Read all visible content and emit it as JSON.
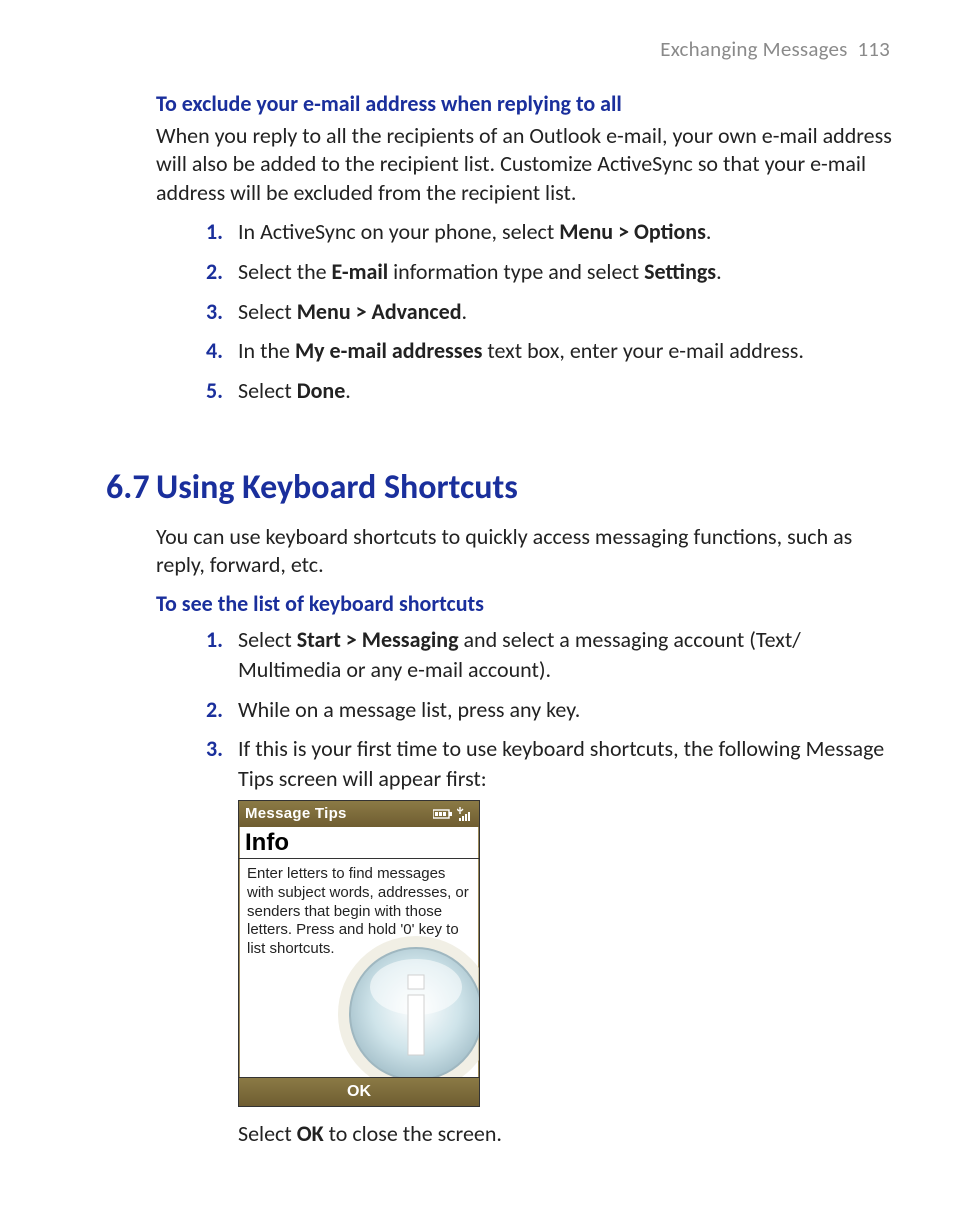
{
  "header": {
    "chapter": "Exchanging Messages",
    "page": "113"
  },
  "section_exclude": {
    "title": "To exclude your e-mail address when replying to all",
    "intro": "When you reply to all the recipients of an Outlook e-mail, your own e-mail address will also be added to the recipient list. Customize ActiveSync so that your e-mail address will be excluded from the recipient list.",
    "steps": [
      {
        "n": "1.",
        "pre": "In ActiveSync on your phone, select ",
        "b1": "Menu > Options",
        "post": "."
      },
      {
        "n": "2.",
        "pre": "Select the ",
        "b1": "E-mail",
        "mid": " information type and select ",
        "b2": "Settings",
        "post": "."
      },
      {
        "n": "3.",
        "pre": "Select ",
        "b1": "Menu > Advanced",
        "post": "."
      },
      {
        "n": "4.",
        "pre": "In the ",
        "b1": "My e-mail addresses",
        "mid": " text box, enter your e-mail address.",
        "post": ""
      },
      {
        "n": "5.",
        "pre": "Select ",
        "b1": "Done",
        "post": "."
      }
    ]
  },
  "section_shortcuts": {
    "number": "6.7",
    "title": "Using Keyboard Shortcuts",
    "intro": "You can use keyboard shortcuts to quickly access messaging functions, such as reply, forward, etc.",
    "sub_title": "To see the list of keyboard shortcuts",
    "steps": {
      "s1": {
        "n": "1.",
        "pre": "Select ",
        "b1": "Start > Messaging",
        "post": " and select a messaging account (Text/ Multimedia or any e-mail account)."
      },
      "s2": {
        "n": "2.",
        "text": "While on a message list, press any key."
      },
      "s3": {
        "n": "3.",
        "text": "If this is your first time to use keyboard shortcuts, the following Message Tips screen will appear first:"
      }
    },
    "phone": {
      "titlebar": "Message Tips",
      "info_label": "Info",
      "body_text": "Enter letters to find messages with subject words, addresses, or senders that begin with those letters.  Press and hold '0' key to list shortcuts.",
      "soft_ok": "OK"
    },
    "after_phone": {
      "pre": "Select ",
      "b1": "OK",
      "post": " to close the screen."
    }
  }
}
